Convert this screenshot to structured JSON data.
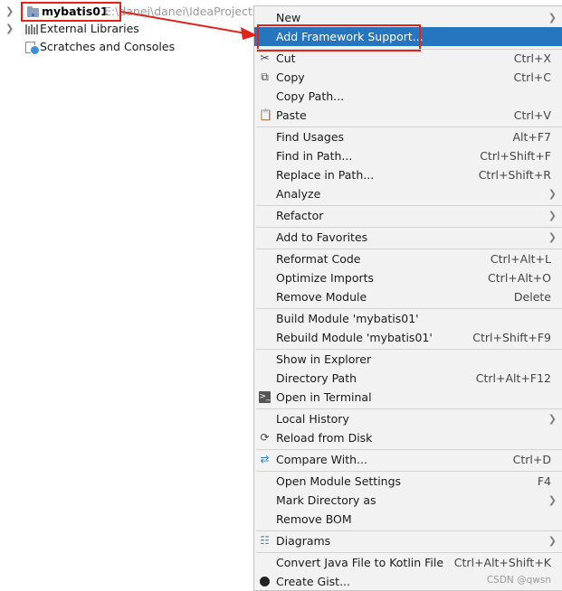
{
  "tree": {
    "root_label": "mybatis01",
    "root_path": "E:\\danei\\danei\\IdeaProjects",
    "items": [
      {
        "label": "External Libraries",
        "icon": "library-icon"
      },
      {
        "label": "Scratches and Consoles",
        "icon": "scratches-icon"
      }
    ]
  },
  "menu": {
    "new": {
      "label": "New"
    },
    "add_framework": {
      "label": "Add Framework Support..."
    },
    "cut": {
      "label": "Cut",
      "shortcut": "Ctrl+X"
    },
    "copy": {
      "label": "Copy",
      "shortcut": "Ctrl+C"
    },
    "copy_path": {
      "label": "Copy Path..."
    },
    "paste": {
      "label": "Paste",
      "shortcut": "Ctrl+V"
    },
    "find_usages": {
      "label": "Find Usages",
      "shortcut": "Alt+F7"
    },
    "find_in_path": {
      "label": "Find in Path...",
      "shortcut": "Ctrl+Shift+F"
    },
    "replace_in_path": {
      "label": "Replace in Path...",
      "shortcut": "Ctrl+Shift+R"
    },
    "analyze": {
      "label": "Analyze"
    },
    "refactor": {
      "label": "Refactor"
    },
    "add_to_favorites": {
      "label": "Add to Favorites"
    },
    "reformat_code": {
      "label": "Reformat Code",
      "shortcut": "Ctrl+Alt+L"
    },
    "optimize_imports": {
      "label": "Optimize Imports",
      "shortcut": "Ctrl+Alt+O"
    },
    "remove_module": {
      "label": "Remove Module",
      "shortcut": "Delete"
    },
    "build_module": {
      "label": "Build Module 'mybatis01'"
    },
    "rebuild_module": {
      "label": "Rebuild Module 'mybatis01'",
      "shortcut": "Ctrl+Shift+F9"
    },
    "show_in_explorer": {
      "label": "Show in Explorer"
    },
    "directory_path": {
      "label": "Directory Path",
      "shortcut": "Ctrl+Alt+F12"
    },
    "open_in_terminal": {
      "label": "Open in Terminal"
    },
    "local_history": {
      "label": "Local History"
    },
    "reload_from_disk": {
      "label": "Reload from Disk"
    },
    "compare_with": {
      "label": "Compare With...",
      "shortcut": "Ctrl+D"
    },
    "open_module_settings": {
      "label": "Open Module Settings",
      "shortcut": "F4"
    },
    "mark_directory_as": {
      "label": "Mark Directory as"
    },
    "remove_bom": {
      "label": "Remove BOM"
    },
    "diagrams": {
      "label": "Diagrams"
    },
    "convert_kotlin": {
      "label": "Convert Java File to Kotlin File",
      "shortcut": "Ctrl+Alt+Shift+K"
    },
    "create_gist": {
      "label": "Create Gist..."
    }
  },
  "watermark": "CSDN @qwsn",
  "colors": {
    "selection": "#2675bf",
    "highlight": "#e2231a",
    "menu_bg": "#f2f2f2"
  }
}
